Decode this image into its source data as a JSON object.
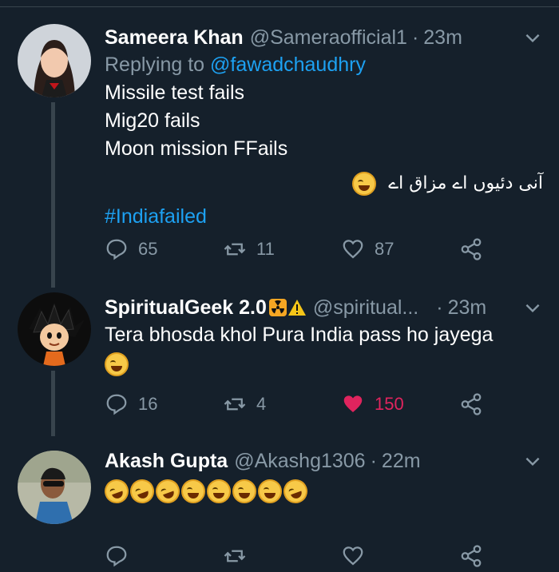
{
  "tweets": [
    {
      "name": "Sameera Khan",
      "handle": "@Sameraofficial1",
      "dot": "·",
      "time": "23m",
      "replying_prefix": "Replying to",
      "replying_to": "@fawadchaudhry",
      "lines": [
        "Missile test fails",
        "Mig20 fails",
        "Moon mission FFails"
      ],
      "urdu": "آنی دئیوں اے مزاق اے",
      "hashtag": "#Indiafailed",
      "replies": "65",
      "retweets": "11",
      "likes": "87"
    },
    {
      "name": "SpiritualGeek 2.0",
      "handle": "@spiritual...",
      "dot": "·",
      "time": "23m",
      "text": "Tera bhosda khol Pura India pass ho jayega",
      "replies": "16",
      "retweets": "4",
      "likes": "150"
    },
    {
      "name": "Akash Gupta",
      "handle": "@Akashg1306",
      "dot": "·",
      "time": "22m",
      "emoji_count": 8
    }
  ],
  "colors": {
    "background": "#15202b",
    "link": "#1da1f2",
    "muted": "#8899a6",
    "like_active": "#e0245e"
  }
}
